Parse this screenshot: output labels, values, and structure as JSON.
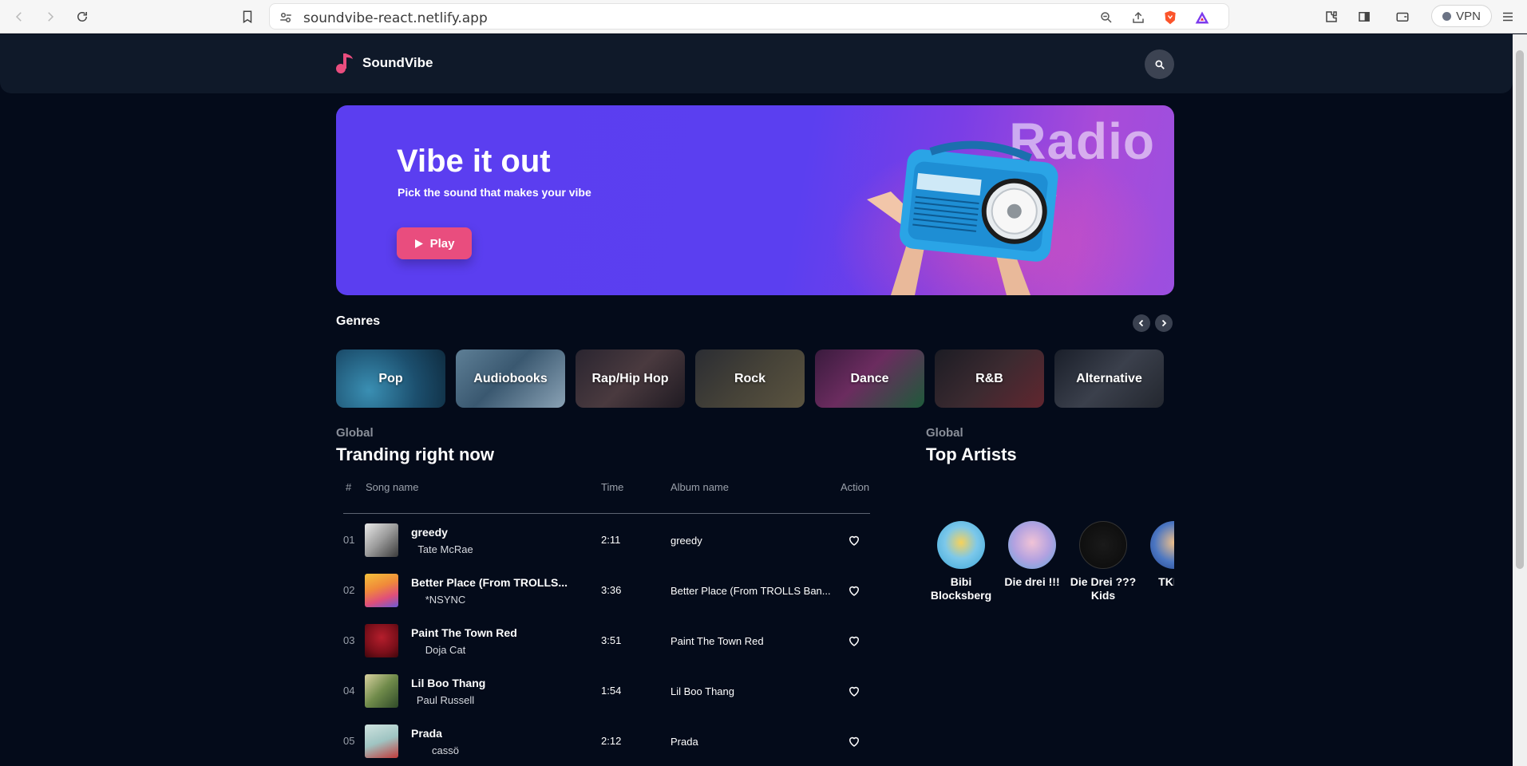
{
  "browser": {
    "url": "soundvibe-react.netlify.app",
    "vpn_label": "VPN"
  },
  "app": {
    "logo_text": "SoundVibe"
  },
  "hero": {
    "title": "Vibe it out",
    "subtitle": "Pick the sound that makes your vibe",
    "play_label": "Play",
    "art_word": "Radio"
  },
  "genres": {
    "heading": "Genres",
    "items": [
      "Pop",
      "Audiobooks",
      "Rap/Hip Hop",
      "Rock",
      "Dance",
      "R&B",
      "Alternative"
    ]
  },
  "trending": {
    "eyebrow": "Global",
    "heading": "Tranding right now",
    "columns": {
      "num": "#",
      "song": "Song name",
      "time": "Time",
      "album": "Album name",
      "action": "Action"
    },
    "rows": [
      {
        "num": "01",
        "title": "greedy",
        "artist": "Tate McRae",
        "time": "2:11",
        "album": "greedy"
      },
      {
        "num": "02",
        "title": "Better Place (From TROLLS...",
        "artist": "*NSYNC",
        "time": "3:36",
        "album": "Better Place (From TROLLS Ban..."
      },
      {
        "num": "03",
        "title": "Paint The Town Red",
        "artist": "Doja Cat",
        "time": "3:51",
        "album": "Paint The Town Red"
      },
      {
        "num": "04",
        "title": "Lil Boo Thang",
        "artist": "Paul Russell",
        "time": "1:54",
        "album": "Lil Boo Thang"
      },
      {
        "num": "05",
        "title": "Prada",
        "artist": "cassö",
        "time": "2:12",
        "album": "Prada"
      }
    ]
  },
  "top_artists": {
    "eyebrow": "Global",
    "heading": "Top Artists",
    "items": [
      {
        "name": "Bibi Blocksberg"
      },
      {
        "name": "Die drei !!!"
      },
      {
        "name": "Die Drei ??? Kids"
      },
      {
        "name": "TKKG"
      }
    ]
  },
  "colors": {
    "page_bg": "#040b1a",
    "topbar_bg": "#0f1929",
    "hero_purple": "#5b3ef0",
    "accent_pink": "#e94d7e"
  }
}
